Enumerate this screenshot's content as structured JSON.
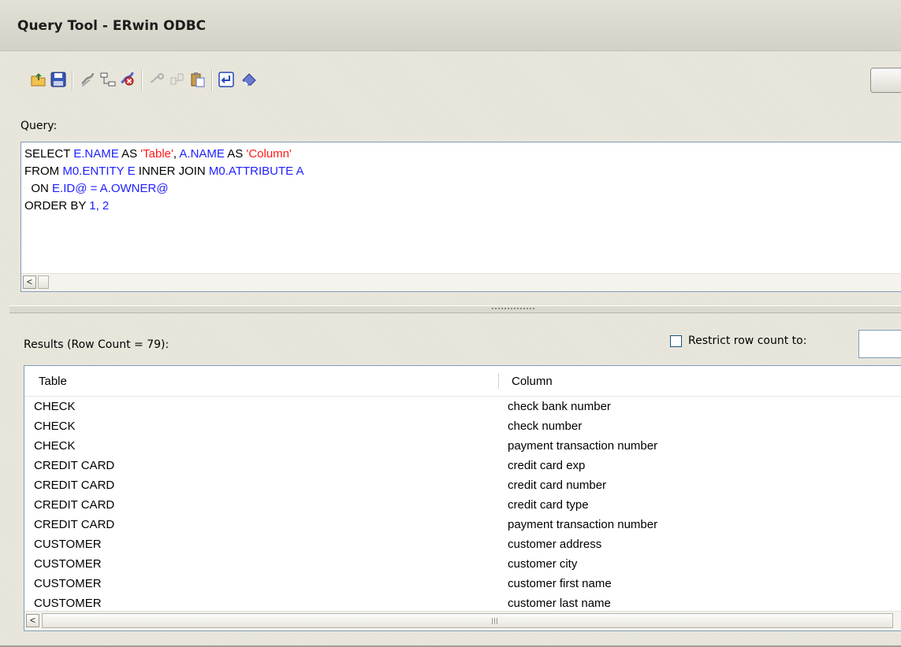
{
  "window": {
    "title": "Query Tool - ERwin ODBC"
  },
  "toolbar": {
    "icons": [
      "open-icon",
      "save-icon",
      "connect-icon",
      "tree-icon",
      "disconnect-icon",
      "link-icon",
      "schema-icon",
      "paste-icon",
      "enter-icon",
      "clear-icon"
    ]
  },
  "query": {
    "label": "Query:",
    "lines": [
      [
        [
          "kw",
          "SELECT "
        ],
        [
          "ident",
          "E.NAME"
        ],
        [
          "kw",
          " AS "
        ],
        [
          "str",
          "'Table'"
        ],
        [
          "kw",
          ", "
        ],
        [
          "ident",
          "A.NAME"
        ],
        [
          "kw",
          " AS "
        ],
        [
          "str",
          "'Column'"
        ]
      ],
      [
        [
          "kw",
          "FROM "
        ],
        [
          "ident",
          "M0.ENTITY E"
        ],
        [
          "kw",
          " INNER JOIN "
        ],
        [
          "ident",
          "M0.ATTRIBUTE A"
        ]
      ],
      [
        [
          "kw",
          "  ON "
        ],
        [
          "ident",
          "E.ID@ = A.OWNER@"
        ]
      ],
      [
        [
          "kw",
          "ORDER BY "
        ],
        [
          "ident",
          "1, 2"
        ]
      ]
    ]
  },
  "results": {
    "label": "Results (Row Count = 79):",
    "restrict_label": "Restrict row count to:",
    "restrict_checked": false,
    "columns": [
      "Table",
      "Column"
    ],
    "rows": [
      [
        "CHECK",
        "check bank number"
      ],
      [
        "CHECK",
        "check number"
      ],
      [
        "CHECK",
        "payment transaction number"
      ],
      [
        "CREDIT CARD",
        "credit card exp"
      ],
      [
        "CREDIT CARD",
        "credit card number"
      ],
      [
        "CREDIT CARD",
        "credit card type"
      ],
      [
        "CREDIT CARD",
        "payment transaction number"
      ],
      [
        "CUSTOMER",
        "customer address"
      ],
      [
        "CUSTOMER",
        "customer city"
      ],
      [
        "CUSTOMER",
        "customer first name"
      ],
      [
        "CUSTOMER",
        "customer last name"
      ]
    ]
  },
  "scroll": {
    "left_arrow": "<"
  }
}
